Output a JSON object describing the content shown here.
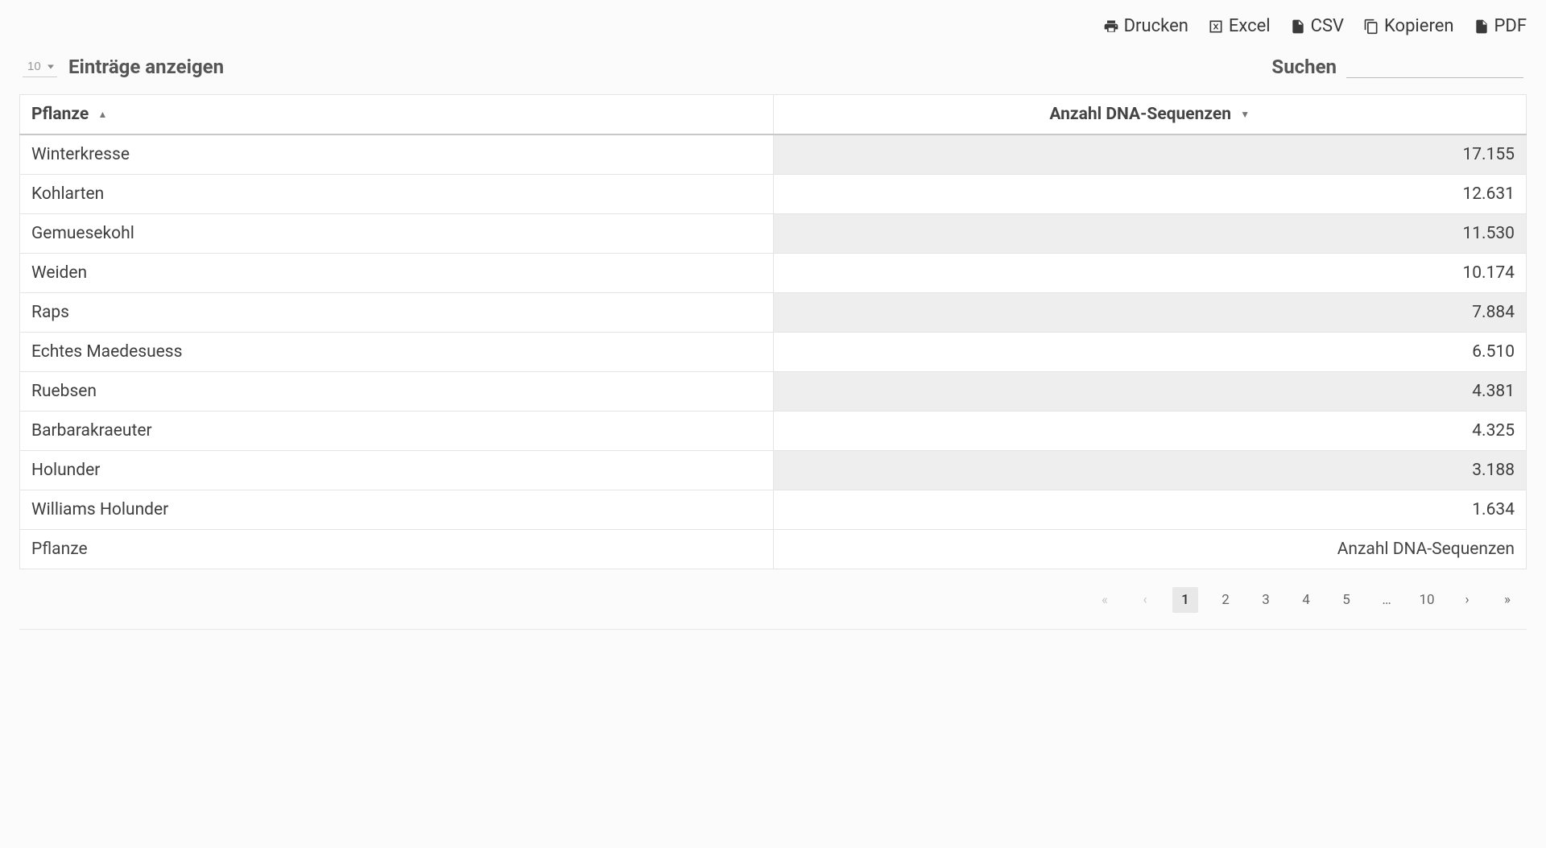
{
  "toolbar": {
    "print": "Drucken",
    "excel": "Excel",
    "csv": "CSV",
    "copy": "Kopieren",
    "pdf": "PDF"
  },
  "controls": {
    "entries_value": "10",
    "entries_label": "Einträge anzeigen",
    "search_label": "Suchen",
    "search_value": ""
  },
  "table": {
    "header_plant": "Pflanze",
    "header_count": "Anzahl DNA-Sequenzen",
    "footer_plant": "Pflanze",
    "footer_count": "Anzahl DNA-Sequenzen",
    "rows": [
      {
        "plant": "Winterkresse",
        "count": "17.155"
      },
      {
        "plant": "Kohlarten",
        "count": "12.631"
      },
      {
        "plant": "Gemuesekohl",
        "count": "11.530"
      },
      {
        "plant": "Weiden",
        "count": "10.174"
      },
      {
        "plant": "Raps",
        "count": "7.884"
      },
      {
        "plant": "Echtes Maedesuess",
        "count": "6.510"
      },
      {
        "plant": "Ruebsen",
        "count": "4.381"
      },
      {
        "plant": "Barbarakraeuter",
        "count": "4.325"
      },
      {
        "plant": "Holunder",
        "count": "3.188"
      },
      {
        "plant": "Williams Holunder",
        "count": "1.634"
      }
    ]
  },
  "pagination": {
    "pages": [
      "1",
      "2",
      "3",
      "4",
      "5",
      "…",
      "10"
    ],
    "active": "1"
  }
}
